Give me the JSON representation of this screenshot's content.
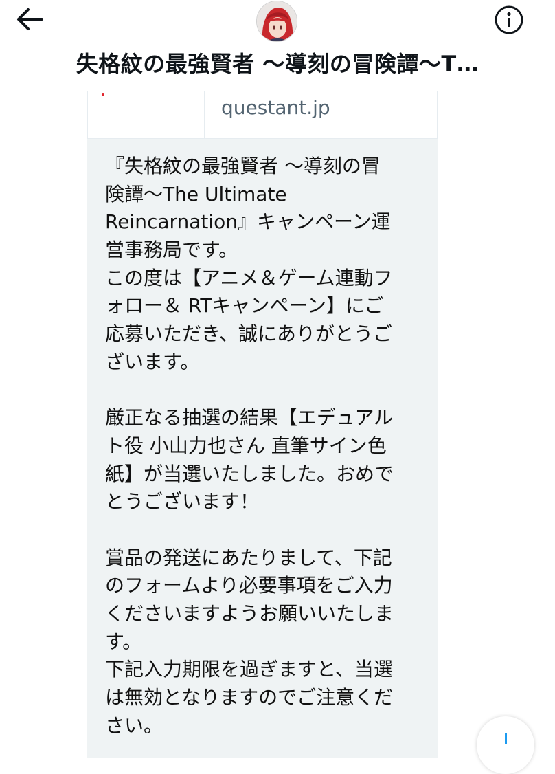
{
  "header": {
    "title": "失格紋の最強賢者 〜導刻の冒険譚〜T…",
    "back_icon": "arrow-left-icon",
    "info_icon": "info-circle-icon"
  },
  "link_card": {
    "domain": "questant.jp"
  },
  "message": {
    "lines": [
      "『失格紋の最強賢者 〜導刻の冒",
      "険譚〜The Ultimate",
      "Reincarnation』キャンペーン運",
      "営事務局です。",
      "この度は【アニメ＆ゲーム連動フ",
      "ォロー＆ RTキャンペーン】にご",
      "応募いただき、誠にありがとうご",
      "ざいます。",
      "",
      "厳正なる抽選の結果【エデュアル",
      "ト役 小山力也さん 直筆サイン色",
      "紙】が当選いたしました。おめで",
      "とうございます！",
      "",
      "賞品の発送にあたりまして、下記",
      "のフォームより必要事項をご入力",
      "くださいますようお願いいたしま",
      "す。",
      "下記入力期限を過ぎますと、当選",
      "は無効となりますのでご注意くだ",
      "さい。"
    ]
  },
  "colors": {
    "bubble_bg": "#eff3f4",
    "link_gray": "#536471",
    "text": "#0f1419"
  }
}
